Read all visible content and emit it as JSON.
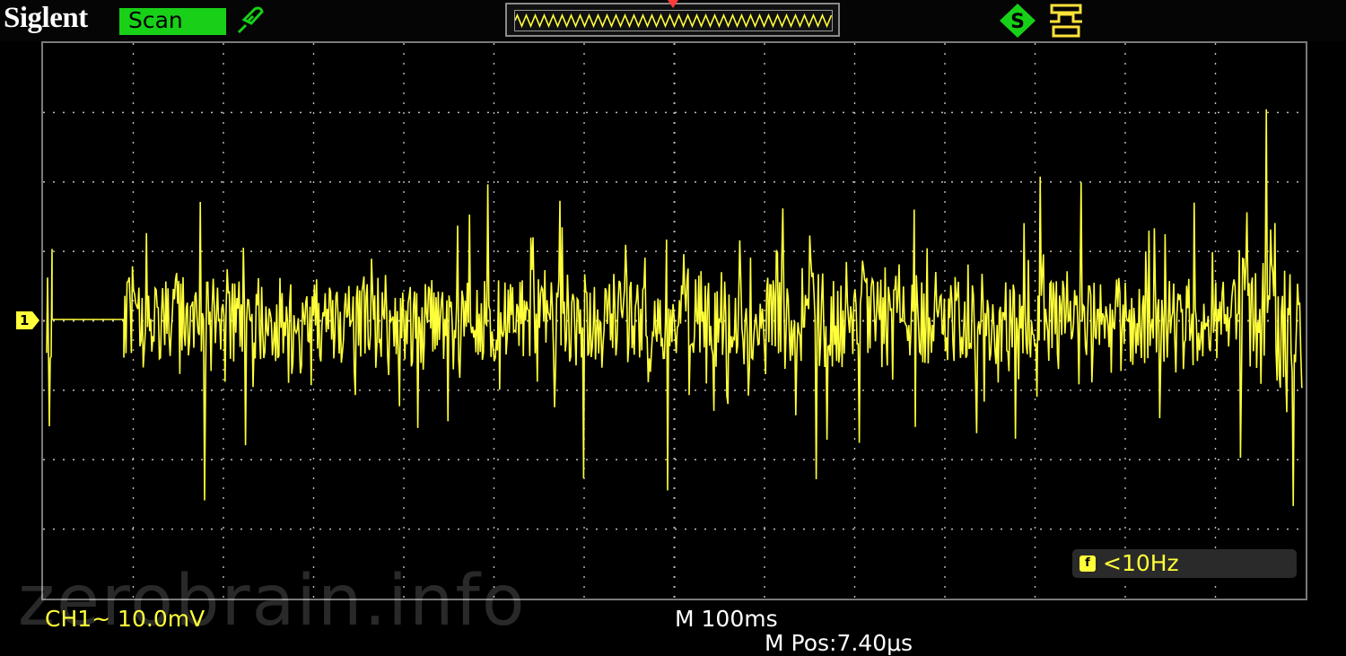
{
  "header": {
    "brand": "Siglent",
    "mode": "Scan"
  },
  "colors": {
    "trace": "#ffff3a",
    "mode_bg": "#18d018",
    "grid_dots": "#bdbdbd",
    "frame": "#7a7a7a",
    "status_icon": "#18d018"
  },
  "icons": {
    "probe": "probe-icon",
    "memory_depth": "memory-depth-bar",
    "trigger_position": "trigger-position-marker",
    "status": "stop-status-icon",
    "trigger_type": "trigger-type-icon",
    "frequency": "frequency-counter-icon"
  },
  "screen": {
    "channel_marker": "1"
  },
  "status": {
    "channel": "CH1~ 10.0mV",
    "timebase": "M 100ms",
    "position": "M Pos:7.40μs",
    "frequency": "<10Hz"
  },
  "watermark": "zerobrain.info"
}
